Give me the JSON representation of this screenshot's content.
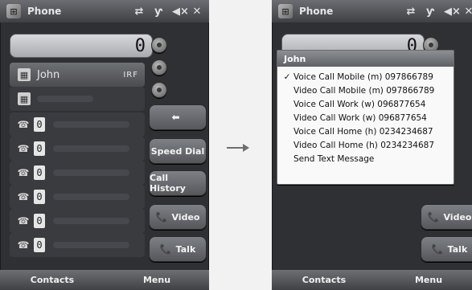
{
  "left": {
    "title": "Phone",
    "display_value": "0",
    "list": {
      "rows": [
        {
          "name": "John",
          "badge": "IRF",
          "selected": true
        },
        {
          "name": "",
          "badge": "",
          "selected": false
        },
        {
          "digit": "0"
        },
        {
          "digit": "0"
        },
        {
          "digit": "0"
        },
        {
          "digit": "0"
        },
        {
          "digit": "0"
        },
        {
          "digit": "0"
        }
      ]
    },
    "buttons": {
      "back_label": "",
      "speed_dial": "Speed Dial",
      "call_history": "Call History",
      "video": "Video",
      "talk": "Talk"
    },
    "softkeys": {
      "left": "Contacts",
      "right": "Menu"
    }
  },
  "right": {
    "title": "Phone",
    "display_value": "0",
    "popup": {
      "header": "John",
      "items": [
        {
          "label": "Voice Call Mobile (m) 097866789",
          "underline_char": "V",
          "checked": true
        },
        {
          "label": "Video Call Mobile (m) 097866789",
          "underline_char": "i",
          "checked": false
        },
        {
          "label": "Voice Call Work (w) 096877654",
          "underline_char": "o",
          "checked": false
        },
        {
          "label": "Video Call Work (w) 096877654",
          "underline_char": "d",
          "checked": false
        },
        {
          "label": "Voice Call Home (h) 0234234687",
          "underline_char": "c",
          "checked": false
        },
        {
          "label": "Video Call Home (h) 0234234687",
          "underline_char": "e",
          "checked": false
        },
        {
          "label": "Send Text Message",
          "underline_char": "S",
          "checked": false
        }
      ]
    },
    "buttons": {
      "video": "Video",
      "talk": "Talk"
    },
    "softkeys": {
      "left": "Contacts",
      "right": "Menu"
    }
  },
  "icons": {
    "windows_logo": "windows-logo-icon",
    "sync": "sync-icon",
    "signal": "signal-icon",
    "volume": "volume-mute-icon",
    "close": "close-icon",
    "contact": "contact-card-icon",
    "phone": "phone-icon",
    "back": "back-arrow-icon",
    "video": "video-icon",
    "talk": "talk-icon",
    "check": "checkmark-icon"
  }
}
